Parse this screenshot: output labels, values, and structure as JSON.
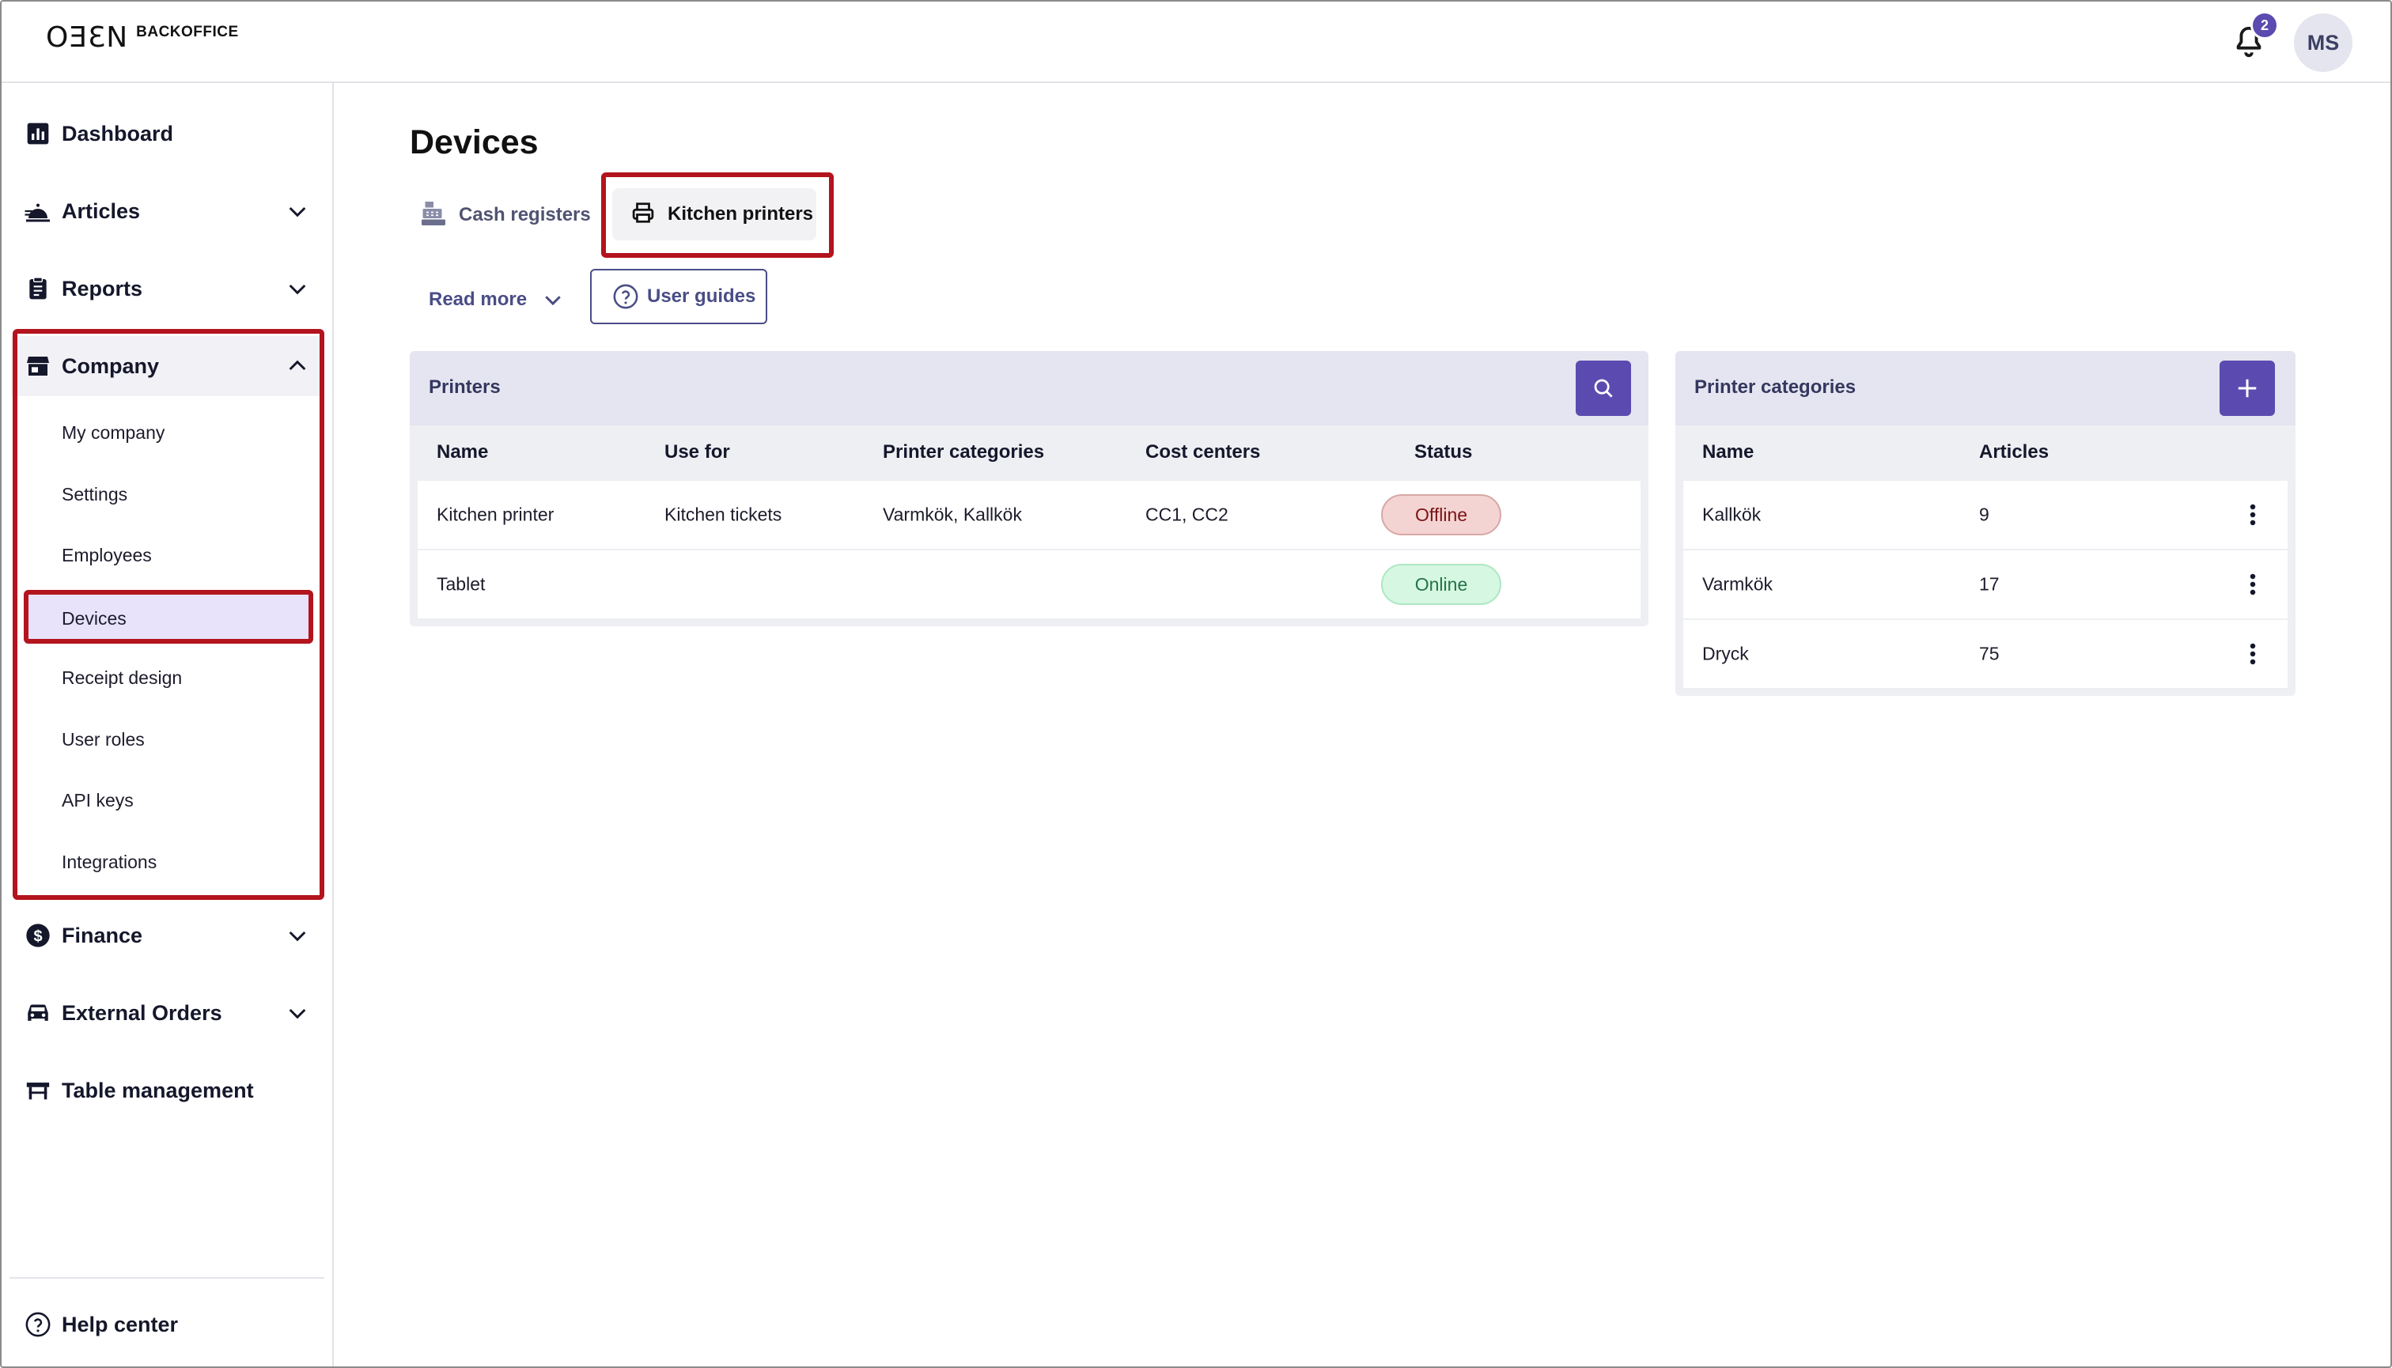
{
  "header": {
    "logo_mark": "OƎƐN",
    "logo_text": "BACKOFFICE",
    "notification_count": "2",
    "avatar_initials": "MS"
  },
  "sidebar": {
    "dashboard": "Dashboard",
    "articles": "Articles",
    "reports": "Reports",
    "company": "Company",
    "company_items": [
      "My company",
      "Settings",
      "Employees",
      "Devices",
      "Receipt design",
      "User roles",
      "API keys",
      "Integrations"
    ],
    "active_item": "Devices",
    "finance": "Finance",
    "external_orders": "External Orders",
    "table_management": "Table management",
    "help_center": "Help center"
  },
  "page": {
    "title": "Devices",
    "tabs": [
      {
        "label": "Cash registers",
        "icon": "cash-register-icon"
      },
      {
        "label": "Kitchen printers",
        "icon": "printer-icon",
        "active": true
      }
    ],
    "read_more": "Read more",
    "user_guides": "User guides"
  },
  "printers": {
    "title": "Printers",
    "columns": [
      "Name",
      "Use for",
      "Printer categories",
      "Cost centers",
      "Status"
    ],
    "rows": [
      {
        "name": "Kitchen printer",
        "use_for": "Kitchen tickets",
        "categories": "Varmkök, Kallkök",
        "cost_centers": "CC1, CC2",
        "status": "Offline"
      },
      {
        "name": "Tablet",
        "use_for": "",
        "categories": "",
        "cost_centers": "",
        "status": "Online"
      }
    ]
  },
  "categories": {
    "title": "Printer categories",
    "columns": [
      "Name",
      "Articles"
    ],
    "rows": [
      {
        "name": "Kallkök",
        "articles": "9"
      },
      {
        "name": "Varmkök",
        "articles": "17"
      },
      {
        "name": "Dryck",
        "articles": "75"
      }
    ]
  },
  "colors": {
    "accent": "#5b4bb0",
    "link": "#4a4d86",
    "highlight": "#b3141d",
    "offline_bg": "#f3d4d3",
    "online_bg": "#d6f7e2"
  }
}
